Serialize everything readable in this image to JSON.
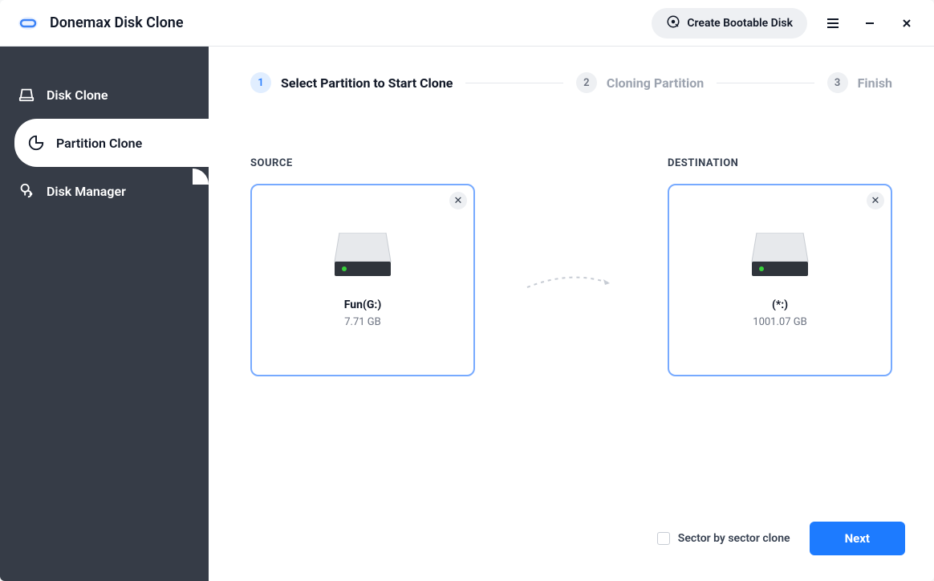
{
  "app": {
    "title": "Donemax Disk Clone"
  },
  "titlebar": {
    "bootable_label": "Create Bootable Disk"
  },
  "sidebar": {
    "items": [
      {
        "label": "Disk Clone"
      },
      {
        "label": "Partition Clone"
      },
      {
        "label": "Disk Manager"
      }
    ]
  },
  "steps": [
    {
      "num": "1",
      "label": "Select Partition to Start Clone"
    },
    {
      "num": "2",
      "label": "Cloning Partition"
    },
    {
      "num": "3",
      "label": "Finish"
    }
  ],
  "panels": {
    "source_title": "SOURCE",
    "destination_title": "DESTINATION",
    "source": {
      "name": "Fun(G:)",
      "size": "7.71 GB"
    },
    "destination": {
      "name": "(*:)",
      "size": "1001.07 GB"
    }
  },
  "footer": {
    "checkbox_label": "Sector by sector clone",
    "next_label": "Next"
  }
}
